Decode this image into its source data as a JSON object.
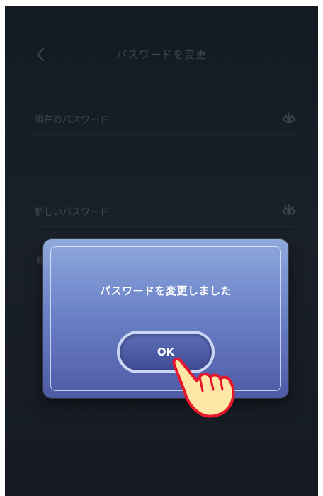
{
  "screen": {
    "title": "パスワードを変更",
    "fields": [
      {
        "label": "現在のパスワード"
      },
      {
        "label": "新しいパスワード"
      }
    ],
    "partial_label": "新"
  },
  "dialog": {
    "message": "パスワードを変更しました",
    "ok_label": "OK"
  },
  "colors": {
    "background": "#161b24",
    "dialog_top": "#8fa9dd",
    "dialog_bottom": "#4e5aa6",
    "button_border": "#c9d6f6",
    "hand_fill": "#fde6a6",
    "hand_outline": "#e8162a"
  },
  "icons": [
    "back-arrow-icon",
    "eye-icon",
    "pointing-hand-icon"
  ]
}
